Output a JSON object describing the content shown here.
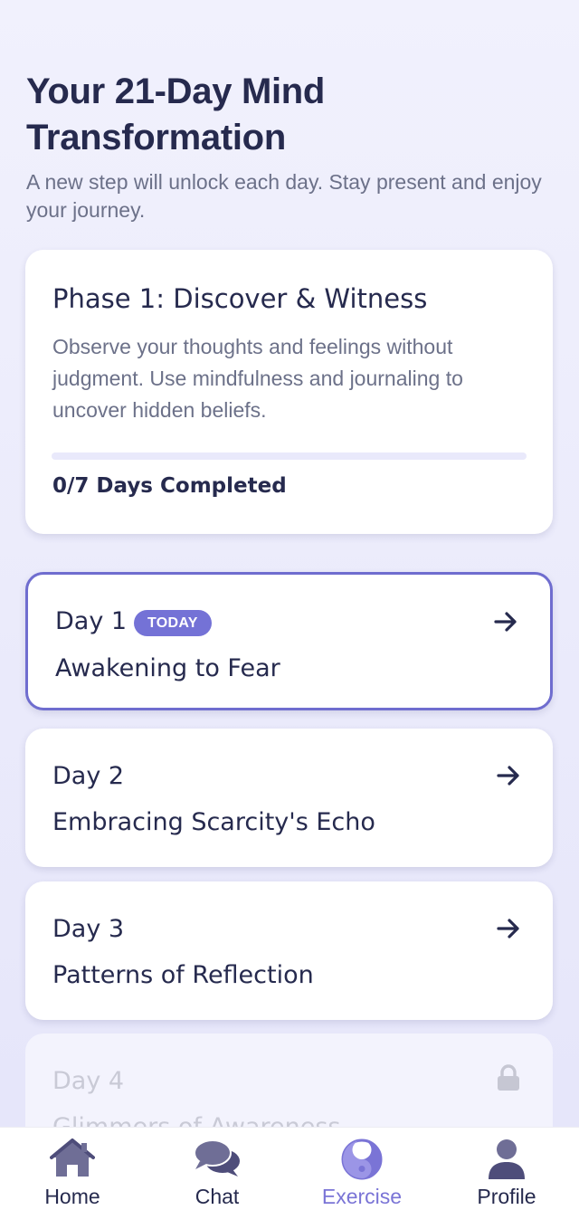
{
  "header": {
    "title": "Your 21-Day Mind Transformation",
    "subtitle": "A new step will unlock each day. Stay present and enjoy your journey."
  },
  "phase": {
    "title": "Phase 1: Discover & Witness",
    "description": "Observe your thoughts and feelings without judgment. Use mindfulness and journaling to uncover hidden beliefs.",
    "progress_fraction": 0,
    "progress_label": "0/7 Days Completed"
  },
  "days": [
    {
      "label": "Day 1",
      "badge": "TODAY",
      "title": "Awakening to Fear",
      "icon": "arrow-right-icon",
      "state": "today"
    },
    {
      "label": "Day 2",
      "title": "Embracing Scarcity's Echo",
      "icon": "arrow-right-icon",
      "state": "unlocked"
    },
    {
      "label": "Day 3",
      "title": "Patterns of Reflection",
      "icon": "arrow-right-icon",
      "state": "unlocked"
    },
    {
      "label": "Day 4",
      "title": "Glimmers of Awareness",
      "icon": "lock-icon",
      "state": "locked"
    }
  ],
  "nav": {
    "items": [
      {
        "label": "Home",
        "icon": "home-icon"
      },
      {
        "label": "Chat",
        "icon": "chat-icon"
      },
      {
        "label": "Exercise",
        "icon": "yin-yang-icon",
        "active": true
      },
      {
        "label": "Profile",
        "icon": "user-icon"
      }
    ]
  },
  "colors": {
    "accent": "#7472d6",
    "text_dark": "#262a4e",
    "text_muted": "#6c7189",
    "locked_text": "#c9cad6"
  }
}
